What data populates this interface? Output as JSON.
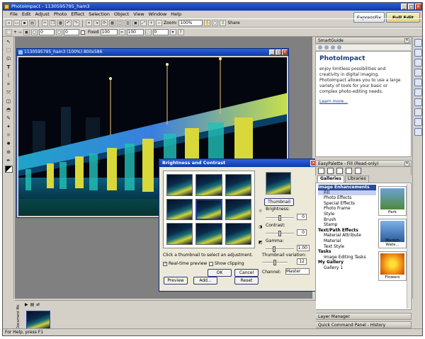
{
  "app": {
    "title": "PhotoImpact - 1130595795_ham3"
  },
  "menu": [
    "File",
    "Edit",
    "Adjust",
    "Photo",
    "Effect",
    "Selection",
    "Object",
    "View",
    "Window",
    "Help"
  ],
  "modes": {
    "expressfix": "ExpressFix",
    "fulledit": "Full Edit"
  },
  "toolbar1": {
    "zoom_label": "Zoom:",
    "zoom_value": "100%",
    "share_label": "Share"
  },
  "toolbar2": {
    "field1": "0",
    "field2": "0",
    "fixed_label": "Fixed",
    "field3": "100",
    "field4": "100",
    "field5": "0"
  },
  "document": {
    "title": "1130595795_ham3 (100%) 800x586"
  },
  "dialog": {
    "title": "Brightness and Contrast",
    "thumbnail_button": "Thumbnail",
    "brightness_label": "Brightness:",
    "brightness_value": "0",
    "contrast_label": "Contrast:",
    "contrast_value": "0",
    "gamma_label": "Gamma:",
    "gamma_value": "1.00",
    "hint": "Click a thumbnail to select an adjustment.",
    "thumb_variation_label": "Thumbnail variation:",
    "thumb_variation_value": "12",
    "channel_label": "Channel:",
    "channel_value": "Master",
    "realtime_label": "Real-time preview",
    "clipping_label": "Show clipping",
    "buttons": {
      "preview": "Preview",
      "add": "Add...",
      "ok": "OK",
      "cancel": "Cancel",
      "reset": "Reset"
    }
  },
  "smartguide": {
    "header": "SmartGuide",
    "heading": "PhotoImpact",
    "body": "enjoy limitless possibilities and creativity in digital imaging. PhotoImpact allows you to use a large variety of tools for your basic or complex photo-editing needs.",
    "link": "Learn more..."
  },
  "easypalette": {
    "header": "EasyPalette - Fill (Read-only)",
    "tabs": [
      "Galleries",
      "Libraries"
    ],
    "tree": [
      {
        "label": "Image Enhancements",
        "bold": true,
        "selected": true
      },
      {
        "label": "Fill",
        "bold": false,
        "selected": true
      },
      {
        "label": "Photo Effects",
        "bold": false
      },
      {
        "label": "Special Effects",
        "bold": false
      },
      {
        "label": "Photo Frame",
        "bold": false
      },
      {
        "label": "Style",
        "bold": false
      },
      {
        "label": "Brush",
        "bold": false
      },
      {
        "label": "Stamp",
        "bold": false
      },
      {
        "label": "Text/Path Effects",
        "bold": true
      },
      {
        "label": "Material Attribute",
        "bold": false
      },
      {
        "label": "Material",
        "bold": false
      },
      {
        "label": "Text Style",
        "bold": false
      },
      {
        "label": "Tasks",
        "bold": true
      },
      {
        "label": "Image Editing Tasks",
        "bold": false
      },
      {
        "label": "My Gallery",
        "bold": true
      },
      {
        "label": "Gallery 1",
        "bold": false
      }
    ],
    "thumbs": [
      "Park",
      "Munich Wate...",
      "Flowers"
    ]
  },
  "layer_manager": "Layer Manager",
  "quick_command": "Quick Command Panel - History",
  "docstrip_label": "Document Mx",
  "status": "For Help, press F1"
}
